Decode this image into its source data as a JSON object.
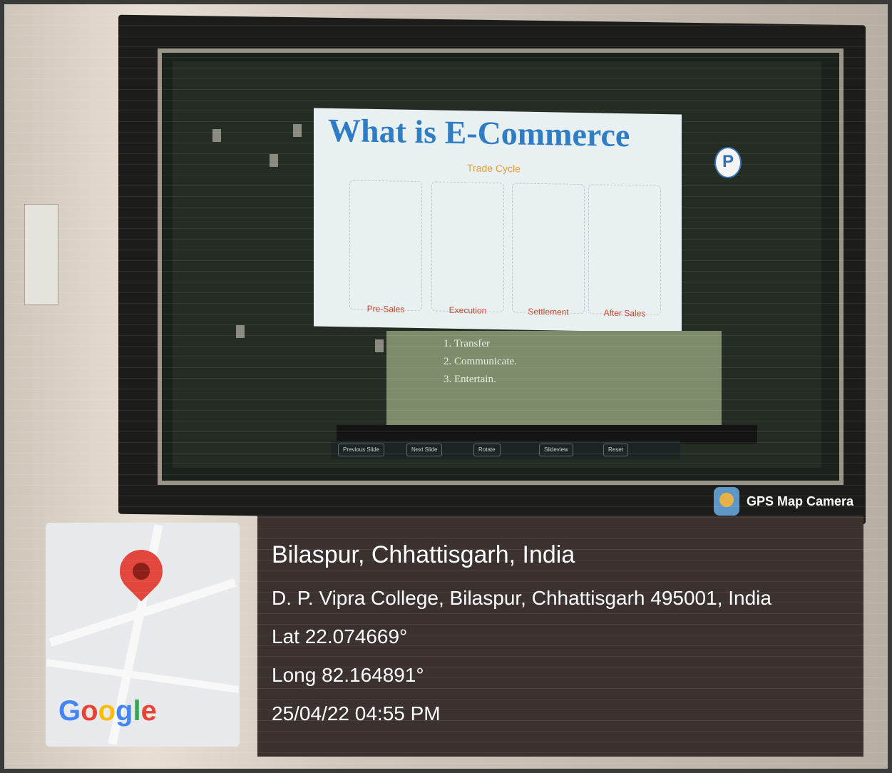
{
  "slide": {
    "title": "What is E-Commerce",
    "subtitle": "Trade Cycle",
    "stages": [
      "Pre-Sales",
      "Execution",
      "Settlement",
      "After Sales"
    ],
    "video_text": [
      "1. Transfer",
      "2. Communicate.",
      "3. Entertain."
    ]
  },
  "toolbar": {
    "buttons": [
      "Previous Slide",
      "Next Slide",
      "Rotate",
      "Slideview",
      "Reset"
    ]
  },
  "overlay": {
    "brand": "GPS Map Camera",
    "city": "Bilaspur, Chhattisgarh, India",
    "address": "D. P. Vipra College, Bilaspur, Chhattisgarh 495001, India",
    "lat": "Lat 22.074669°",
    "long": "Long 82.164891°",
    "datetime": "25/04/22 04:55 PM",
    "map_brand": "Google"
  },
  "icons": {
    "map_pin": "map-pin-icon",
    "brand": "gps-map-camera-icon",
    "logo": "college-logo-icon"
  }
}
